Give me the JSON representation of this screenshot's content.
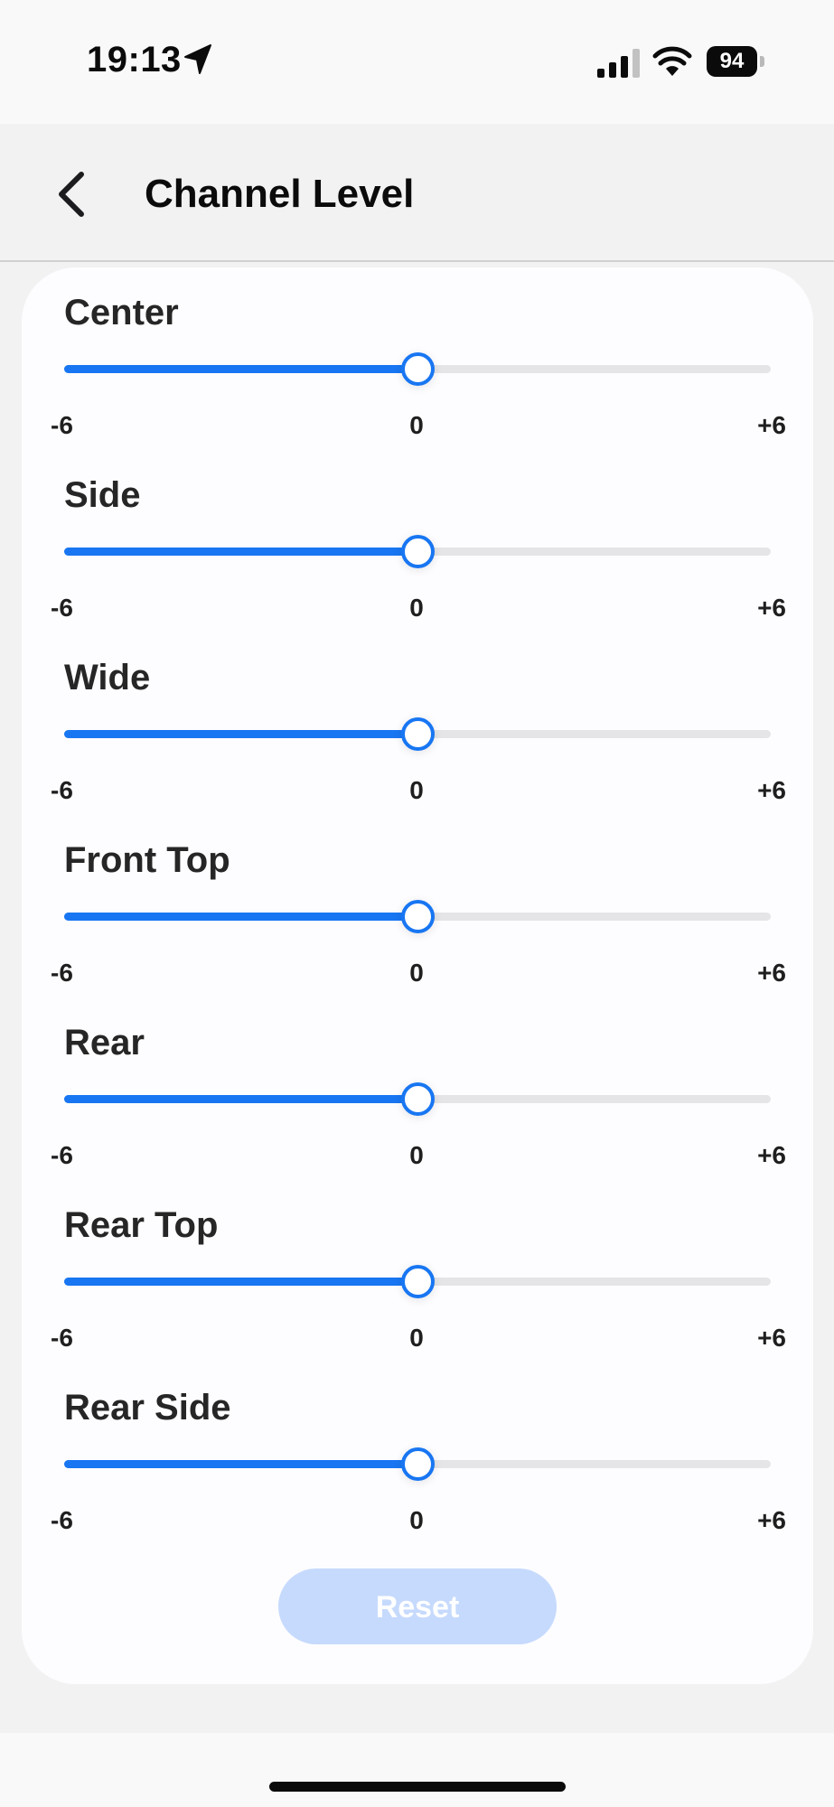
{
  "status_bar": {
    "time": "19:13",
    "battery": "94",
    "icons": [
      "location-arrow-icon",
      "cellular-signal-icon",
      "wifi-icon",
      "battery-icon"
    ]
  },
  "header": {
    "title": "Channel Level",
    "back_icon": "chevron-left-icon"
  },
  "range": {
    "min_label": "-6",
    "mid_label": "0",
    "max_label": "+6",
    "min": -6,
    "max": 6
  },
  "channels": [
    {
      "label": "Center",
      "value": 0
    },
    {
      "label": "Side",
      "value": 0
    },
    {
      "label": "Wide",
      "value": 0
    },
    {
      "label": "Front Top",
      "value": 0
    },
    {
      "label": "Rear",
      "value": 0
    },
    {
      "label": "Rear Top",
      "value": 0
    },
    {
      "label": "Rear Side",
      "value": 0
    }
  ],
  "reset_label": "Reset",
  "colors": {
    "accent": "#1876f2",
    "track": "#e5e5e7",
    "reset_disabled": "#c6dafd"
  }
}
